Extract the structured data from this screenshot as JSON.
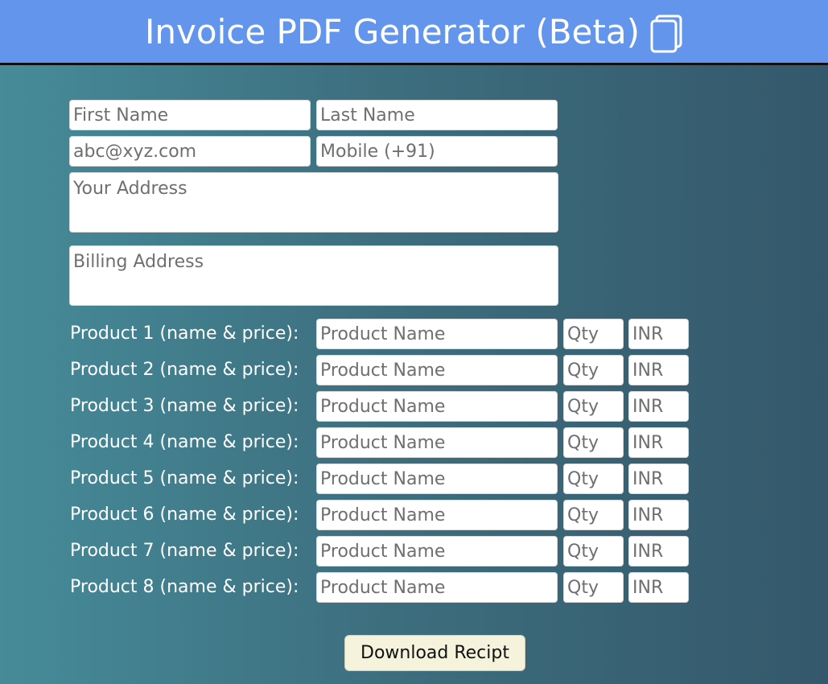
{
  "header": {
    "title": "Invoice PDF Generator (Beta)",
    "icon": "copy-icon",
    "background": "#6495ed"
  },
  "form": {
    "first_name_placeholder": "First Name",
    "last_name_placeholder": "Last Name",
    "email_placeholder": "abc@xyz.com",
    "mobile_placeholder": "Mobile (+91)",
    "address_placeholder": "Your Address",
    "billing_placeholder": "Billing Address"
  },
  "products": [
    {
      "label": "Product 1 (name & price):",
      "name_placeholder": "Product Name",
      "qty_placeholder": "Qty",
      "price_placeholder": "INR"
    },
    {
      "label": "Product 2 (name & price):",
      "name_placeholder": "Product Name",
      "qty_placeholder": "Qty",
      "price_placeholder": "INR"
    },
    {
      "label": "Product 3 (name & price):",
      "name_placeholder": "Product Name",
      "qty_placeholder": "Qty",
      "price_placeholder": "INR"
    },
    {
      "label": "Product 4 (name & price):",
      "name_placeholder": "Product Name",
      "qty_placeholder": "Qty",
      "price_placeholder": "INR"
    },
    {
      "label": "Product 5 (name & price):",
      "name_placeholder": "Product Name",
      "qty_placeholder": "Qty",
      "price_placeholder": "INR"
    },
    {
      "label": "Product 6 (name & price):",
      "name_placeholder": "Product Name",
      "qty_placeholder": "Qty",
      "price_placeholder": "INR"
    },
    {
      "label": "Product 7 (name & price):",
      "name_placeholder": "Product Name",
      "qty_placeholder": "Qty",
      "price_placeholder": "INR"
    },
    {
      "label": "Product 8 (name & price):",
      "name_placeholder": "Product Name",
      "qty_placeholder": "Qty",
      "price_placeholder": "INR"
    }
  ],
  "actions": {
    "download_label": "Download Recipt"
  }
}
